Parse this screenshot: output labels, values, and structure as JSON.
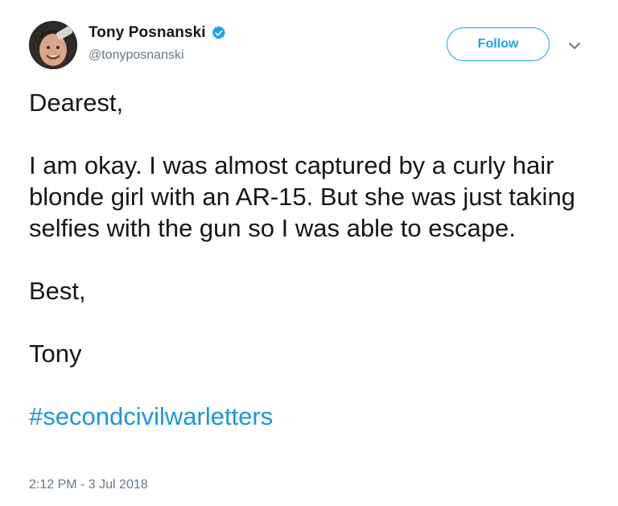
{
  "author": {
    "display_name": "Tony Posnanski",
    "handle": "@tonyposnanski",
    "verified": true,
    "avatar_icon": "profile-photo-avatar"
  },
  "actions": {
    "follow_label": "Follow",
    "menu_icon": "chevron-down-icon"
  },
  "tweet": {
    "paragraphs": [
      "Dearest,",
      "I am okay. I was almost captured by a curly hair blonde girl with an AR-15. But she was just taking selfies with the gun so I was able to escape.",
      "Best,",
      "Tony"
    ],
    "hashtag": "#secondcivilwarletters",
    "timestamp": "2:12 PM - 3 Jul 2018"
  },
  "colors": {
    "accent": "#1da1f2",
    "hashtag": "#1b95e0",
    "text": "#14171a",
    "muted": "#657786"
  }
}
